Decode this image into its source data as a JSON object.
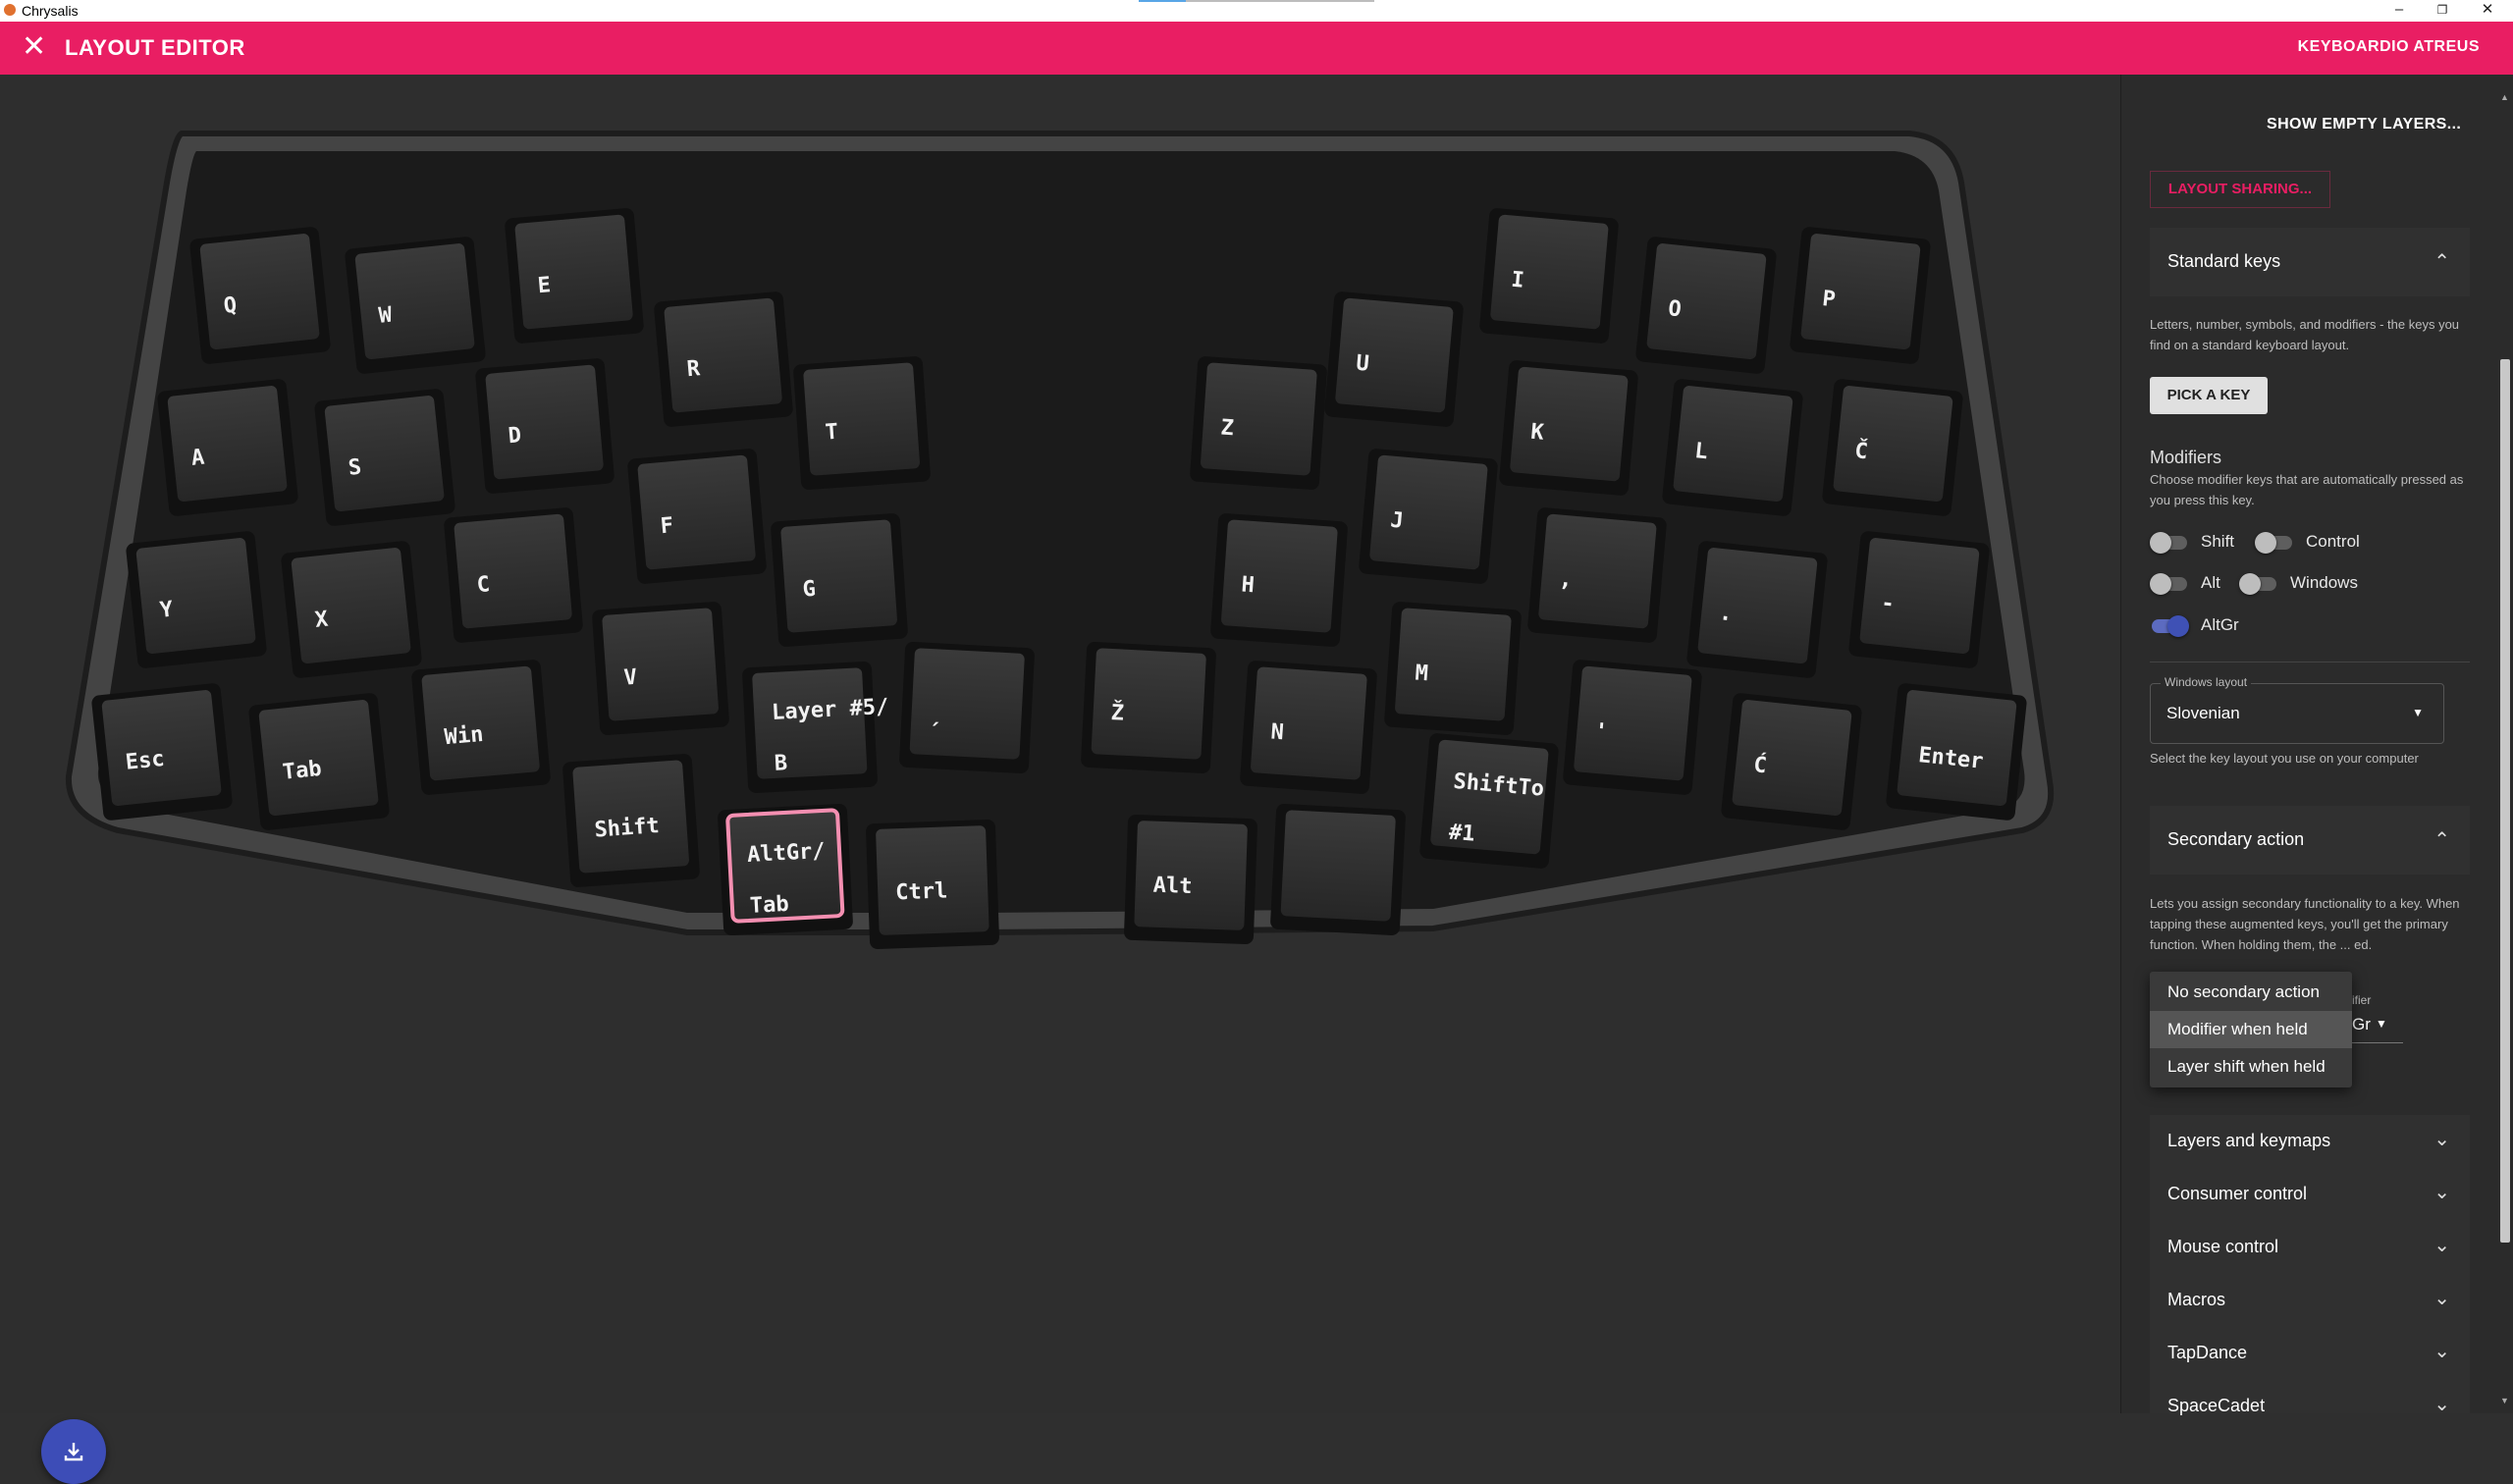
{
  "window": {
    "app_name": "Chrysalis",
    "minimize": "–",
    "restore": "❐",
    "close": "✕"
  },
  "appbar": {
    "close_icon": "✕",
    "title": "LAYOUT EDITOR",
    "device": "KEYBOARDIO ATREUS"
  },
  "keyboard": {
    "selected_key": "AltGr/ Tab",
    "keys": [
      {
        "id": "q",
        "lines": [
          "Q"
        ]
      },
      {
        "id": "w",
        "lines": [
          "W"
        ]
      },
      {
        "id": "e",
        "lines": [
          "E"
        ]
      },
      {
        "id": "r",
        "lines": [
          "R"
        ]
      },
      {
        "id": "t",
        "lines": [
          "T"
        ]
      },
      {
        "id": "a",
        "lines": [
          "A"
        ]
      },
      {
        "id": "s",
        "lines": [
          "S"
        ]
      },
      {
        "id": "d",
        "lines": [
          "D"
        ]
      },
      {
        "id": "f",
        "lines": [
          "F"
        ]
      },
      {
        "id": "g",
        "lines": [
          "G"
        ]
      },
      {
        "id": "y",
        "lines": [
          "Y"
        ]
      },
      {
        "id": "x",
        "lines": [
          "X"
        ]
      },
      {
        "id": "c",
        "lines": [
          "C"
        ]
      },
      {
        "id": "v",
        "lines": [
          "V"
        ]
      },
      {
        "id": "layer5b",
        "lines": [
          "Layer #5/",
          "B"
        ]
      },
      {
        "id": "esc",
        "lines": [
          "Esc"
        ]
      },
      {
        "id": "tab",
        "lines": [
          "Tab"
        ]
      },
      {
        "id": "win",
        "lines": [
          "Win"
        ]
      },
      {
        "id": "shift",
        "lines": [
          "Shift"
        ]
      },
      {
        "id": "altgrtab",
        "lines": [
          "AltGr/",
          "Tab"
        ],
        "selected": true
      },
      {
        "id": "ctrl",
        "lines": [
          "Ctrl"
        ]
      },
      {
        "id": "backtick",
        "lines": [
          "ˏ"
        ]
      },
      {
        "id": "u",
        "lines": [
          "U"
        ]
      },
      {
        "id": "i",
        "lines": [
          "I"
        ]
      },
      {
        "id": "o",
        "lines": [
          "O"
        ]
      },
      {
        "id": "p",
        "lines": [
          "P"
        ]
      },
      {
        "id": "z",
        "lines": [
          "Z"
        ]
      },
      {
        "id": "k",
        "lines": [
          "K"
        ]
      },
      {
        "id": "l",
        "lines": [
          "L"
        ]
      },
      {
        "id": "ccaron",
        "lines": [
          "Č"
        ]
      },
      {
        "id": "h",
        "lines": [
          "H"
        ]
      },
      {
        "id": "j",
        "lines": [
          "J"
        ]
      },
      {
        "id": "comma",
        "lines": [
          ","
        ]
      },
      {
        "id": "period",
        "lines": [
          "."
        ]
      },
      {
        "id": "minus",
        "lines": [
          "-"
        ]
      },
      {
        "id": "zcaron",
        "lines": [
          "Ž"
        ]
      },
      {
        "id": "n",
        "lines": [
          "N"
        ]
      },
      {
        "id": "m",
        "lines": [
          "M"
        ]
      },
      {
        "id": "shiftto1",
        "lines": [
          "ShiftTo",
          "#1"
        ]
      },
      {
        "id": "apostrophe",
        "lines": [
          "'"
        ]
      },
      {
        "id": "cacute",
        "lines": [
          "Ć"
        ]
      },
      {
        "id": "enter",
        "lines": [
          "Enter"
        ]
      },
      {
        "id": "alt",
        "lines": [
          "Alt"
        ]
      },
      {
        "id": "blank",
        "lines": [
          ""
        ]
      }
    ]
  },
  "fab": {
    "icon": "download-icon"
  },
  "panel": {
    "show_empty_layers": "SHOW EMPTY LAYERS...",
    "layout_sharing": "LAYOUT SHARING...",
    "standard_keys": {
      "title": "Standard keys",
      "description": "Letters, number, symbols, and modifiers - the keys you find on a standard keyboard layout.",
      "pick_button": "PICK A KEY"
    },
    "modifiers": {
      "title": "Modifiers",
      "description": "Choose modifier keys that are automatically pressed as you press this key.",
      "items": [
        {
          "label": "Shift",
          "on": false
        },
        {
          "label": "Control",
          "on": false
        },
        {
          "label": "Alt",
          "on": false
        },
        {
          "label": "Windows",
          "on": false
        },
        {
          "label": "AltGr",
          "on": true
        }
      ]
    },
    "windows_layout": {
      "legend": "Windows layout",
      "value": "Slovenian",
      "help": "Select the key layout you use on your computer"
    },
    "secondary_action": {
      "title": "Secondary action",
      "description": "Lets you assign secondary functionality to a key. When tapping these augmented keys, you'll get the primary function. When holding them, the ... ed.",
      "mini_legend": "ifier",
      "mini_value": "Gr",
      "menu": [
        "No secondary action",
        "Modifier when held",
        "Layer shift when held"
      ],
      "menu_selected": "Modifier when held"
    },
    "sections": [
      "Layers and keymaps",
      "Consumer control",
      "Mouse control",
      "Macros",
      "TapDance",
      "SpaceCadet"
    ]
  },
  "colors": {
    "accent": "#e91e63",
    "toggle_on": "#3f51b5",
    "fab": "#3d4db7"
  }
}
